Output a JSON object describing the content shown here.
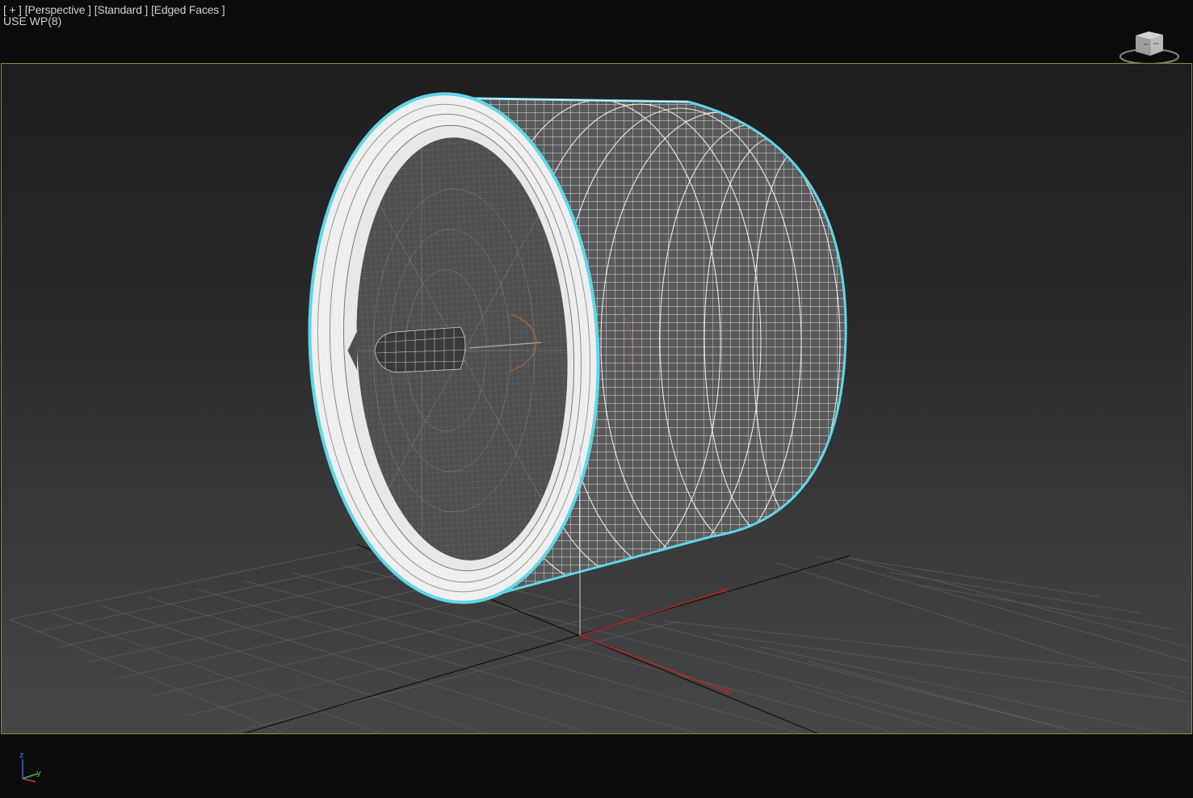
{
  "viewport": {
    "label_plus": "[ + ]",
    "label_view": "[Perspective ]",
    "label_shading": "[Standard ]",
    "label_faces": "[Edged Faces ]",
    "use_wp": "USE WP(8)",
    "frame_color": "#8f8a3c",
    "selection_color": "#5fd6e8"
  },
  "axis_tripod": {
    "z": "z",
    "y": "y",
    "x": "x"
  },
  "icons": [
    "viewcube-icon",
    "axis-tripod-icon",
    "world-axis-gizmo-icon"
  ]
}
